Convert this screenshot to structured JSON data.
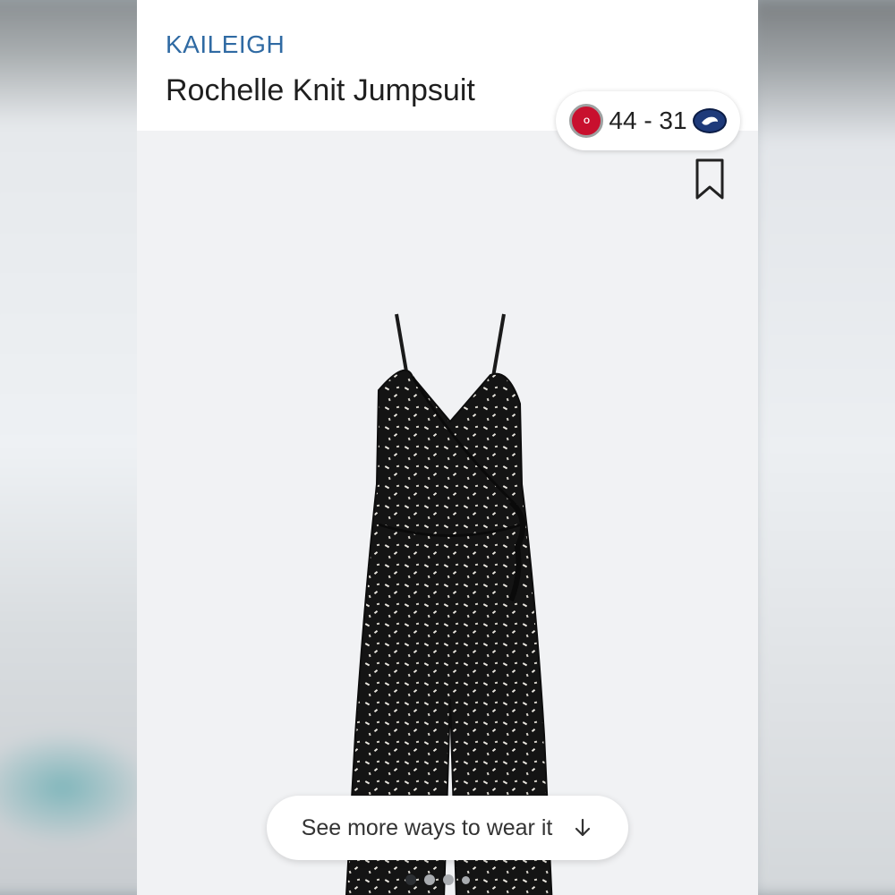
{
  "product": {
    "brand": "KAILEIGH",
    "name": "Rochelle Knit Jumpsuit"
  },
  "score_widget": {
    "team_left": "Ohio State",
    "score_text": "44 - 31",
    "team_right": "Penn State",
    "team_left_color": "#c8102e",
    "team_right_color": "#1e3a7a"
  },
  "actions": {
    "save_icon": "bookmark-icon",
    "see_more_label": "See more ways to wear it",
    "see_more_icon": "arrow-down-icon"
  },
  "carousel": {
    "total_pages": 4,
    "current_page": 1
  },
  "colors": {
    "brand_text": "#2f6aa3",
    "title_text": "#1f1f1f",
    "photo_bg": "#f1f2f4"
  }
}
